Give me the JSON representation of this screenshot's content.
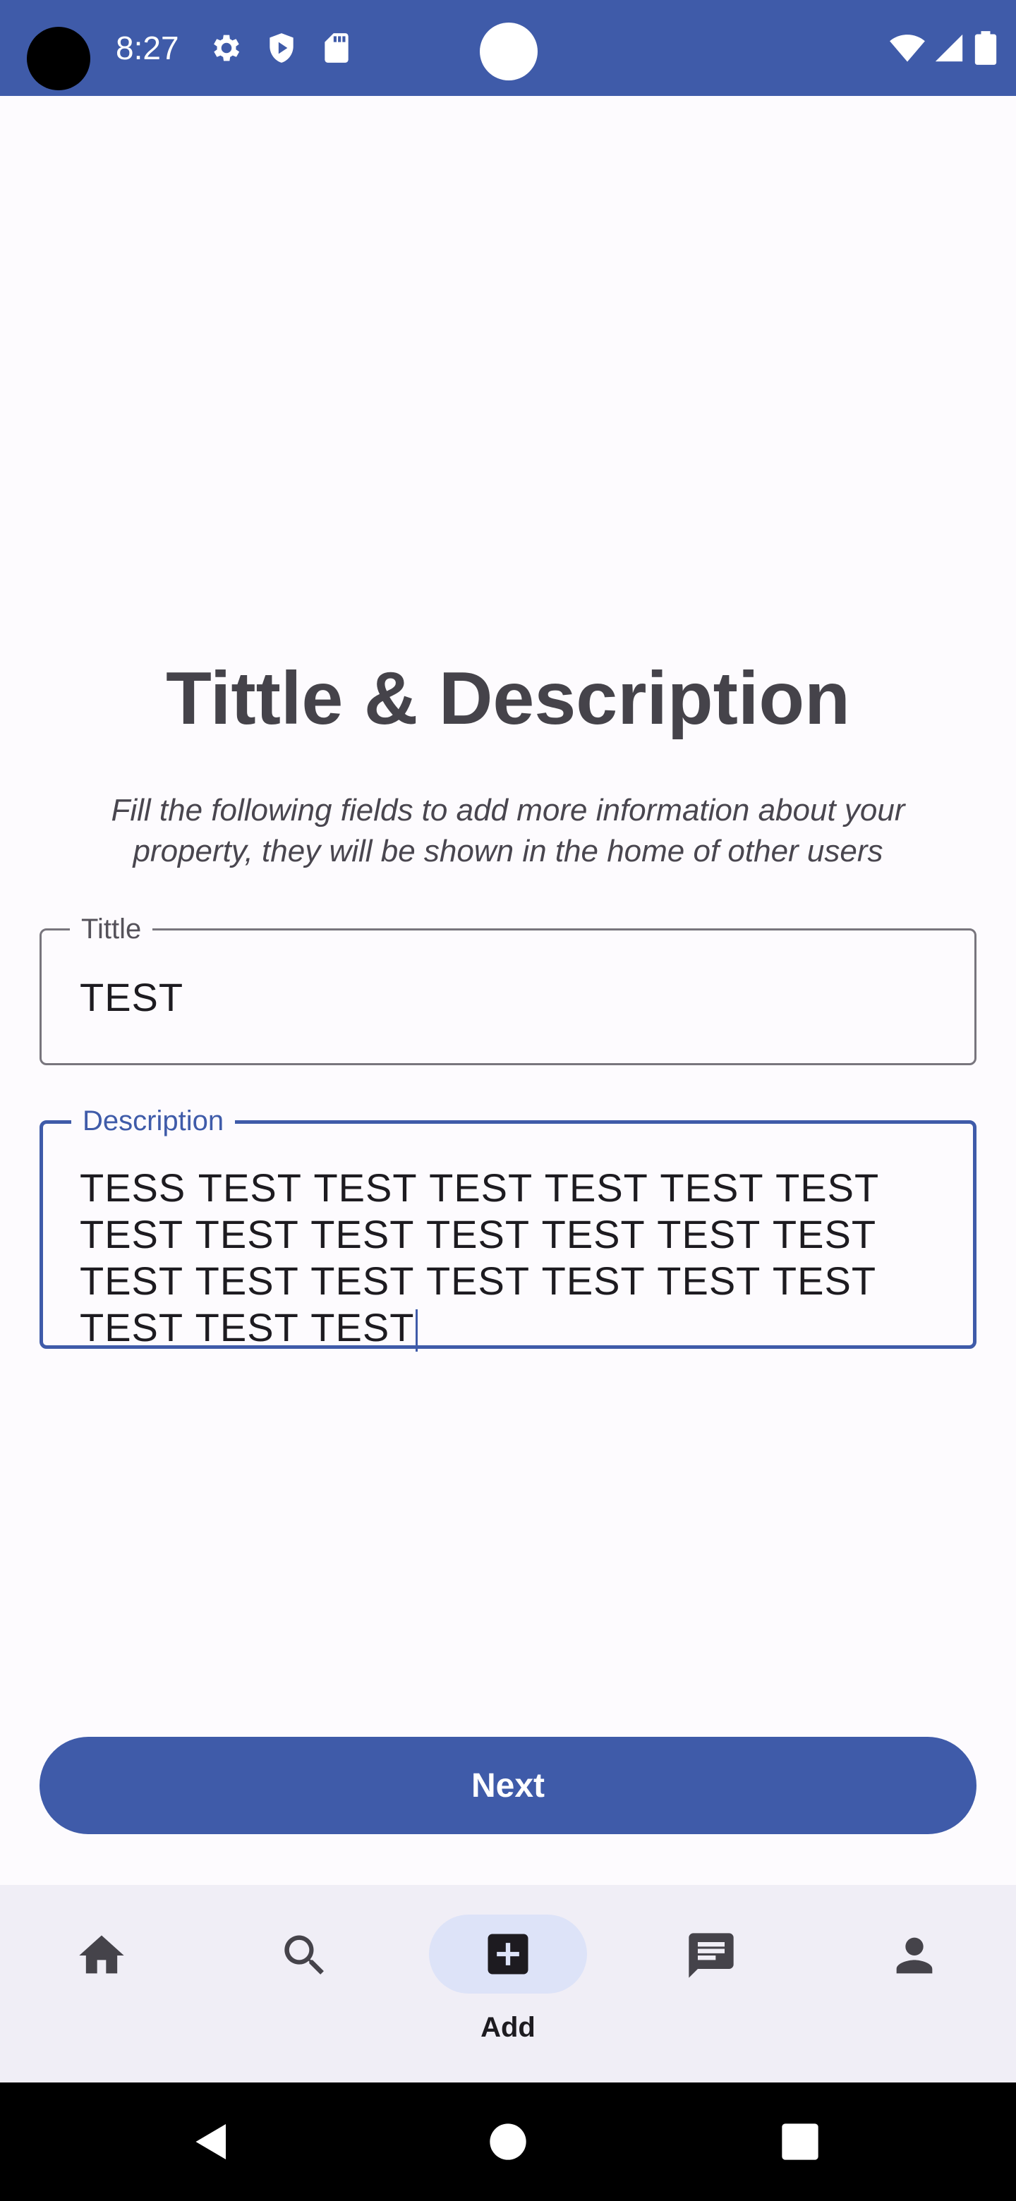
{
  "status_bar": {
    "time": "8:27",
    "icons": [
      "gear-icon",
      "shield-play-icon",
      "sd-card-icon",
      "wifi-icon",
      "signal-icon",
      "battery-icon"
    ]
  },
  "page": {
    "title": "Tittle & Description",
    "subtitle": "Fill the following fields to add more information about your property, they will be shown in the home of other users"
  },
  "form": {
    "title_field": {
      "label": "Tittle",
      "value": "TEST"
    },
    "description_field": {
      "label": "Description",
      "value": "TESS TEST TEST TEST TEST TEST TEST TEST TEST TEST TEST TEST TEST TEST TEST TEST TEST TEST TEST TEST TEST TEST TEST TEST"
    },
    "next_label": "Next"
  },
  "bottom_nav": {
    "items": [
      {
        "icon": "home-icon",
        "label": ""
      },
      {
        "icon": "search-icon",
        "label": ""
      },
      {
        "icon": "add-box-icon",
        "label": "Add",
        "active": true
      },
      {
        "icon": "chat-icon",
        "label": ""
      },
      {
        "icon": "person-icon",
        "label": ""
      }
    ]
  },
  "colors": {
    "primary": "#3f5ba9",
    "background": "#fdfbfe",
    "nav_background": "#f0eef6",
    "active_indicator": "#dde3f8",
    "title_text": "#45434a"
  }
}
